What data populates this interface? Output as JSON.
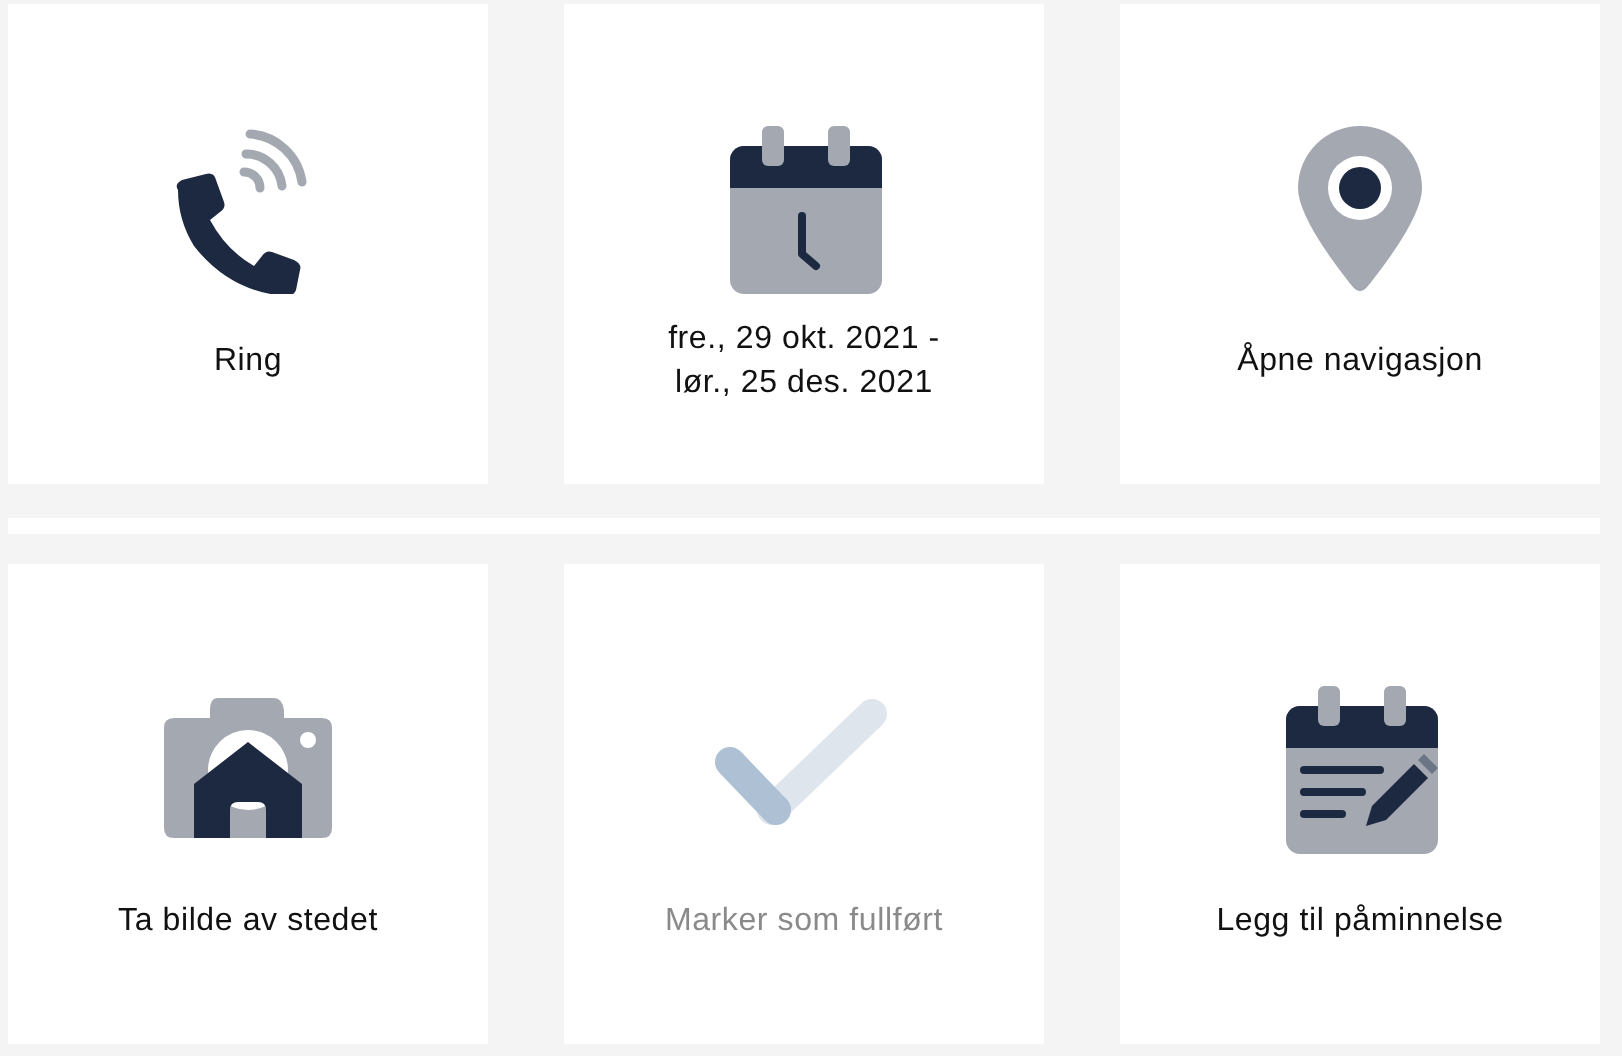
{
  "actions": [
    {
      "kind": "call",
      "label": "Ring",
      "disabled": false
    },
    {
      "kind": "schedule",
      "label": "fre., 29 okt. 2021 -\nlør., 25 des. 2021",
      "disabled": false
    },
    {
      "kind": "navigate",
      "label": "Åpne navigasjon",
      "disabled": false
    },
    {
      "kind": "photo",
      "label": "Ta bilde av stedet",
      "disabled": false
    },
    {
      "kind": "complete",
      "label": "Marker som fullført",
      "disabled": true
    },
    {
      "kind": "reminder",
      "label": "Legg til påminnelse",
      "disabled": false
    }
  ]
}
